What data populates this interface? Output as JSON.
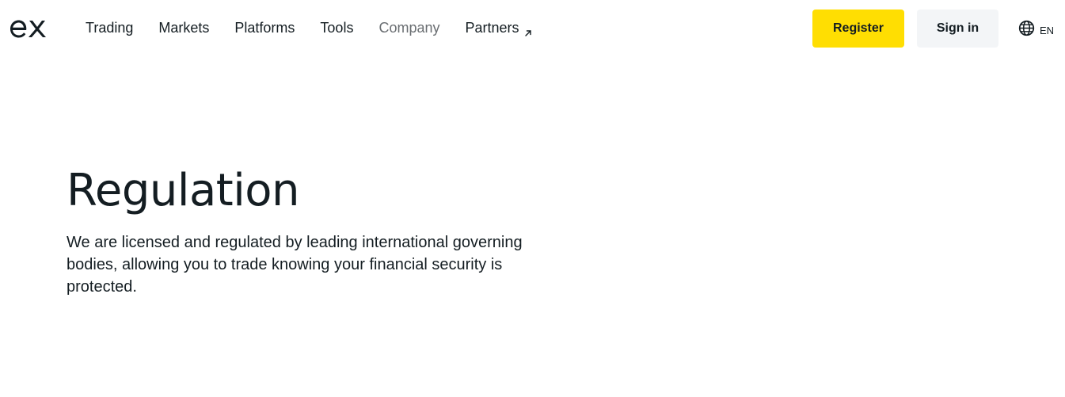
{
  "header": {
    "logo_text": "ex",
    "nav": [
      {
        "label": "Trading"
      },
      {
        "label": "Markets"
      },
      {
        "label": "Platforms"
      },
      {
        "label": "Tools"
      },
      {
        "label": "Company"
      },
      {
        "label": "Partners"
      }
    ],
    "register_label": "Register",
    "signin_label": "Sign in",
    "language": "EN",
    "colors": {
      "register_bg": "#ffde02",
      "signin_bg": "#f3f5f7",
      "text": "#141d22",
      "muted_nav": "#6a6e72"
    }
  },
  "hero": {
    "title": "Regulation",
    "description": "We are licensed and regulated by leading international governing bodies, allowing you to trade knowing your financial security is protected."
  }
}
